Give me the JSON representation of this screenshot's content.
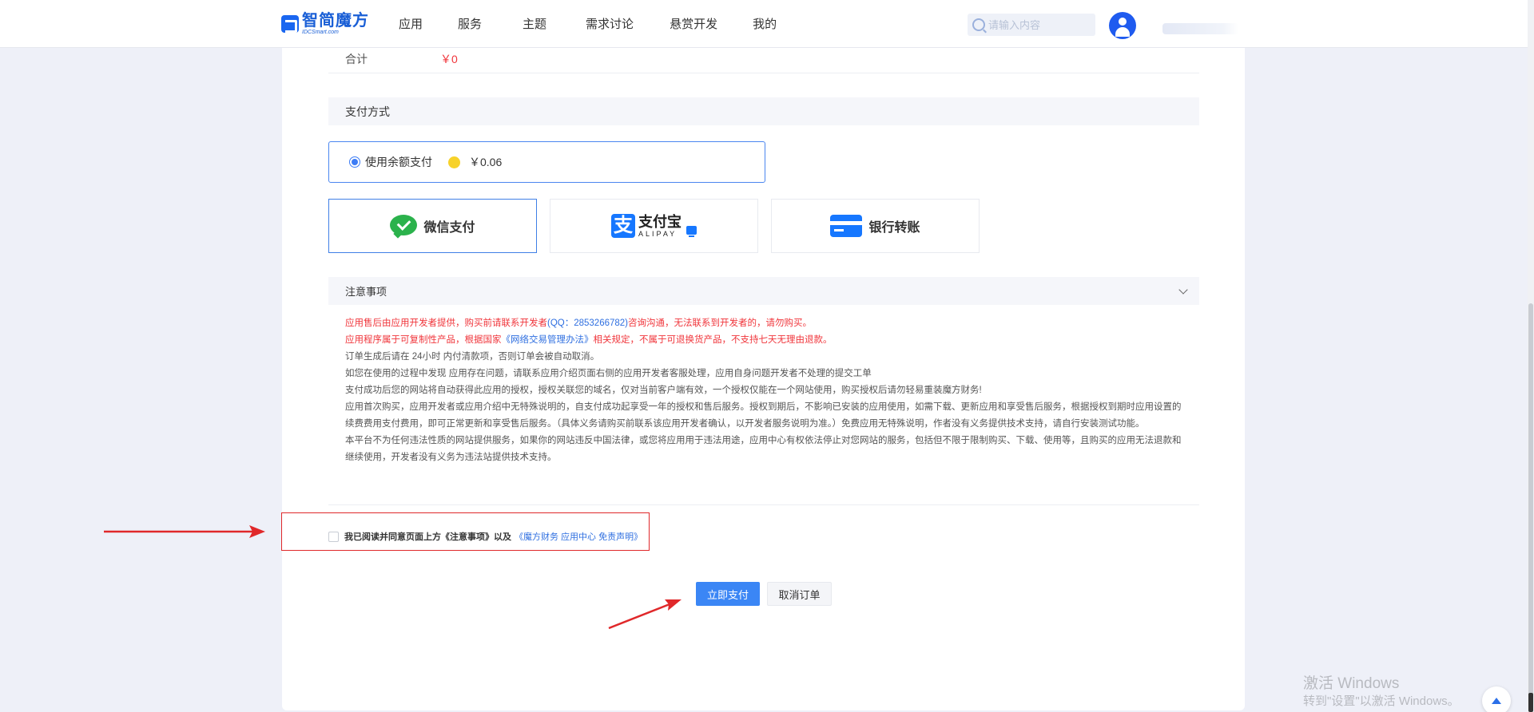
{
  "header": {
    "logo_cn": "智简魔方",
    "logo_en": "IDCSmart.com",
    "nav": [
      "应用",
      "服务",
      "主题",
      "需求讨论",
      "悬赏开发",
      "我的"
    ],
    "search_placeholder": "请输入内容"
  },
  "order": {
    "total_label": "合计",
    "total_value": "￥0"
  },
  "payment": {
    "section_title": "支付方式",
    "balance_label": "使用余额支付",
    "balance_amount": "￥0.06",
    "methods": {
      "wechat": "微信支付",
      "alipay_cn": "支付宝",
      "alipay_en": "ALIPAY",
      "bank": "银行转账"
    }
  },
  "notice": {
    "title": "注意事项",
    "line1_red_a": "应用售后由应用开发者提供，购买前请联系开发者",
    "line1_link": "(QQ：2853266782)",
    "line1_red_b": "咨询沟通，无法联系到开发者的，请勿购买。",
    "line2_red_a": "应用程序属于可复制性产品，根据国家",
    "line2_link": "《网络交易管理办法》",
    "line2_red_b": "相关规定，不属于可退换货产品，不支持七天无理由退款。",
    "line3": "订单生成后请在 24小时 内付清款项，否则订单会被自动取消。",
    "line4": "如您在使用的过程中发现 应用存在问题，请联系应用介绍页面右侧的应用开发者客服处理，应用自身问题开发者不处理的提交工单",
    "line5": "支付成功后您的网站将自动获得此应用的授权，授权关联您的域名，仅对当前客户端有效，一个授权仅能在一个网站使用，购买授权后请勿轻易重装魔方财务!",
    "line6": "应用首次购买，应用开发者或应用介绍中无特殊说明的，自支付成功起享受一年的授权和售后服务。授权到期后，不影响已安装的应用使用，如需下载、更新应用和享受售后服务，根据授权到期时应用设置的续费费用支付费用，即可正常更新和享受售后服务。（具体义务请购买前联系该应用开发者确认，以开发者服务说明为准。）免费应用无特殊说明，作者没有义务提供技术支持，请自行安装测试功能。",
    "line7": "本平台不为任何违法性质的网站提供服务，如果你的网站违反中国法律，或您将应用用于违法用途，应用中心有权依法停止对您网站的服务，包括但不限于限制购买、下载、使用等，且购买的应用无法退款和继续使用，开发者没有义务为违法站提供技术支持。"
  },
  "agreement": {
    "text": "我已阅读并同意页面上方《注意事项》以及",
    "link": "《魔方财务 应用中心 免责声明》"
  },
  "actions": {
    "pay": "立即支付",
    "cancel": "取消订单"
  },
  "watermark": {
    "line1": "激活 Windows",
    "line2": "转到\"设置\"以激活 Windows。"
  },
  "colors": {
    "accent": "#3b86f5",
    "price_red": "#f0353b",
    "annotation_red": "#e0282a"
  }
}
